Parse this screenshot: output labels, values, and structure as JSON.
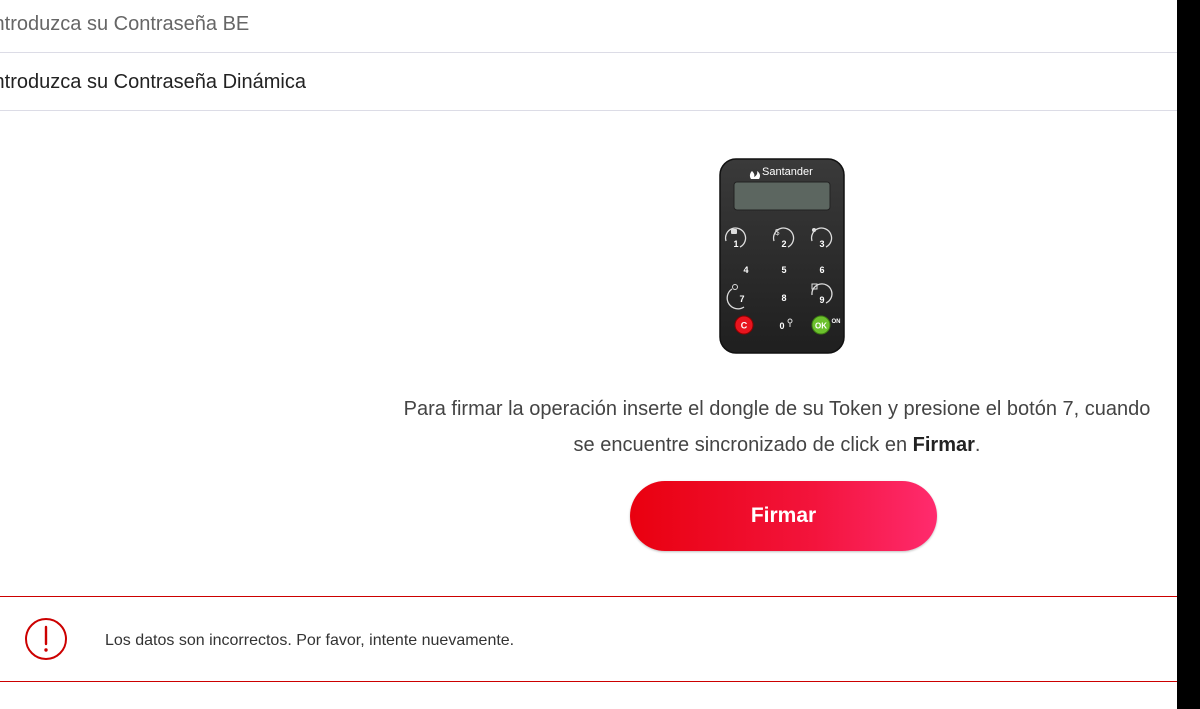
{
  "form": {
    "password_be_label": "Introduzca su Contraseña BE",
    "password_dynamic_label": "Introduzca su Contraseña Dinámica"
  },
  "token": {
    "brand": "Santander",
    "keys": [
      "1",
      "2",
      "3",
      "4",
      "5",
      "6",
      "7",
      "8",
      "9",
      "C",
      "0",
      "OK"
    ],
    "on_label": "ON",
    "colors": {
      "body": "#2b2b2b",
      "screen": "#5c6660",
      "cancel": "#e8141e",
      "ok": "#6cc12d"
    }
  },
  "instructions": {
    "text_before": "Para firmar la operación inserte el dongle de su Token y presione el botón 7, cuando se encuentre sincronizado de click en ",
    "bold": "Firmar",
    "text_after": "."
  },
  "actions": {
    "sign_label": "Firmar"
  },
  "alert": {
    "icon": "exclamation-circle-icon",
    "message": "Los datos son incorrectos. Por favor, intente nuevamente."
  },
  "colors": {
    "brand_red": "#ec0000",
    "alert_border": "#cc0000"
  }
}
